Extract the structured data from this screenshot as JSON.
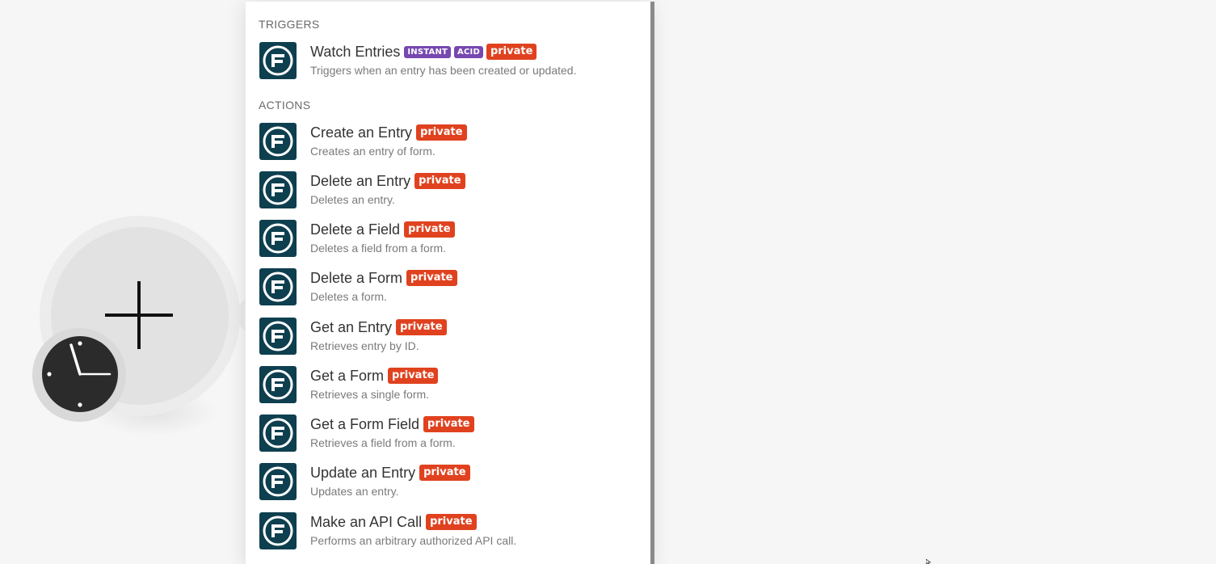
{
  "sections": {
    "triggers_title": "TRIGGERS",
    "actions_title": "ACTIONS"
  },
  "triggers": [
    {
      "title": "Watch Entries",
      "badges": [
        "INSTANT",
        "ACID",
        "private"
      ],
      "description": "Triggers when an entry has been created or updated."
    }
  ],
  "actions": [
    {
      "title": "Create an Entry",
      "badge": "private",
      "description": "Creates an entry of form."
    },
    {
      "title": "Delete an Entry",
      "badge": "private",
      "description": "Deletes an entry."
    },
    {
      "title": "Delete a Field",
      "badge": "private",
      "description": "Deletes a field from a form."
    },
    {
      "title": "Delete a Form",
      "badge": "private",
      "description": "Deletes a form."
    },
    {
      "title": "Get an Entry",
      "badge": "private",
      "description": "Retrieves entry by ID."
    },
    {
      "title": "Get a Form",
      "badge": "private",
      "description": "Retrieves a single form."
    },
    {
      "title": "Get a Form Field",
      "badge": "private",
      "description": "Retrieves a field from a form."
    },
    {
      "title": "Update an Entry",
      "badge": "private",
      "description": "Updates an entry."
    },
    {
      "title": "Make an API Call",
      "badge": "private",
      "description": "Performs an arbitrary authorized API call."
    }
  ],
  "icons": {
    "app_logo": "formidable-forms-icon",
    "add": "plus-icon",
    "schedule": "clock-icon"
  },
  "colors": {
    "app_logo_bg": "#0e3f4f",
    "private_badge": "#e0421f",
    "instant_badge": "#7648b0",
    "canvas_bg": "#f6f6f6"
  }
}
